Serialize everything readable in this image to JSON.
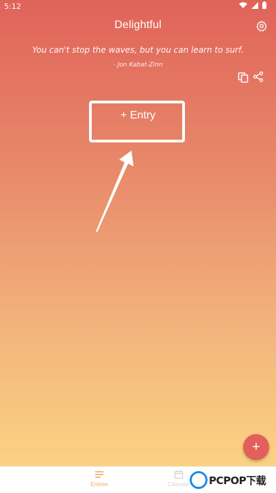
{
  "status_bar": {
    "time": "5:12",
    "icons": [
      "wifi-icon",
      "signal-icon",
      "battery-icon"
    ]
  },
  "header": {
    "title": "Delightful",
    "settings_icon": "gear-icon"
  },
  "quote": {
    "text": "You can't stop the waves, but you can learn to surf.",
    "author": "- Jon Kabat-Zinn",
    "actions": [
      "copy-icon",
      "share-icon"
    ]
  },
  "entry_button": {
    "label": "+ Entry"
  },
  "fab": {
    "label": "+"
  },
  "bottom_nav": {
    "items": [
      {
        "label": "Entries",
        "icon": "list-icon",
        "active": true
      },
      {
        "label": "Calendar",
        "icon": "calendar-icon",
        "active": false
      }
    ]
  },
  "watermark": {
    "logo": "P",
    "text": "PCPOP下载"
  },
  "colors": {
    "gradient_top": "#e0635a",
    "gradient_bottom": "#fcd884",
    "fab": "#e35f5a",
    "nav_active": "#f1a95f"
  }
}
